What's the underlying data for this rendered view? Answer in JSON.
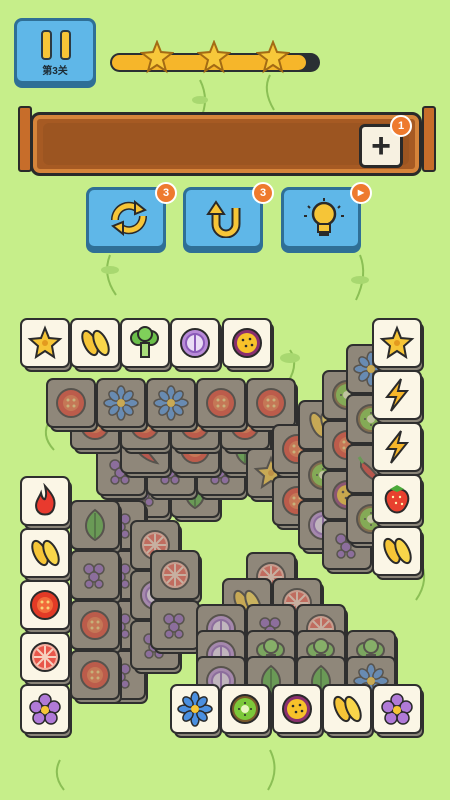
{
  "header": {
    "pause_icon": "pause-icon",
    "level_label": "第3关",
    "progress": 0.94,
    "stars_earned": 3
  },
  "slot_board": {
    "add_badge": "1"
  },
  "tools": [
    {
      "name": "shuffle",
      "icon": "shuffle-icon",
      "badge": "3"
    },
    {
      "name": "undo",
      "icon": "undo-icon",
      "badge": "3"
    },
    {
      "name": "hint",
      "icon": "lightbulb-icon",
      "badge": "▶"
    }
  ],
  "tile_icons": [
    "starfruit",
    "corn",
    "broccoli",
    "onion",
    "passion-fruit",
    "lightning",
    "flame",
    "strawberry",
    "tomato",
    "kiwi",
    "blue-flower",
    "purple-flower",
    "grapefruit",
    "leaf",
    "chili",
    "grape"
  ],
  "colors": {
    "background": "#c6ee8a",
    "button_blue": "#5fb7e8",
    "tray_brown": "#a65a23",
    "badge_orange": "#ee7a2e",
    "progress_yellow": "#f6b62a"
  }
}
